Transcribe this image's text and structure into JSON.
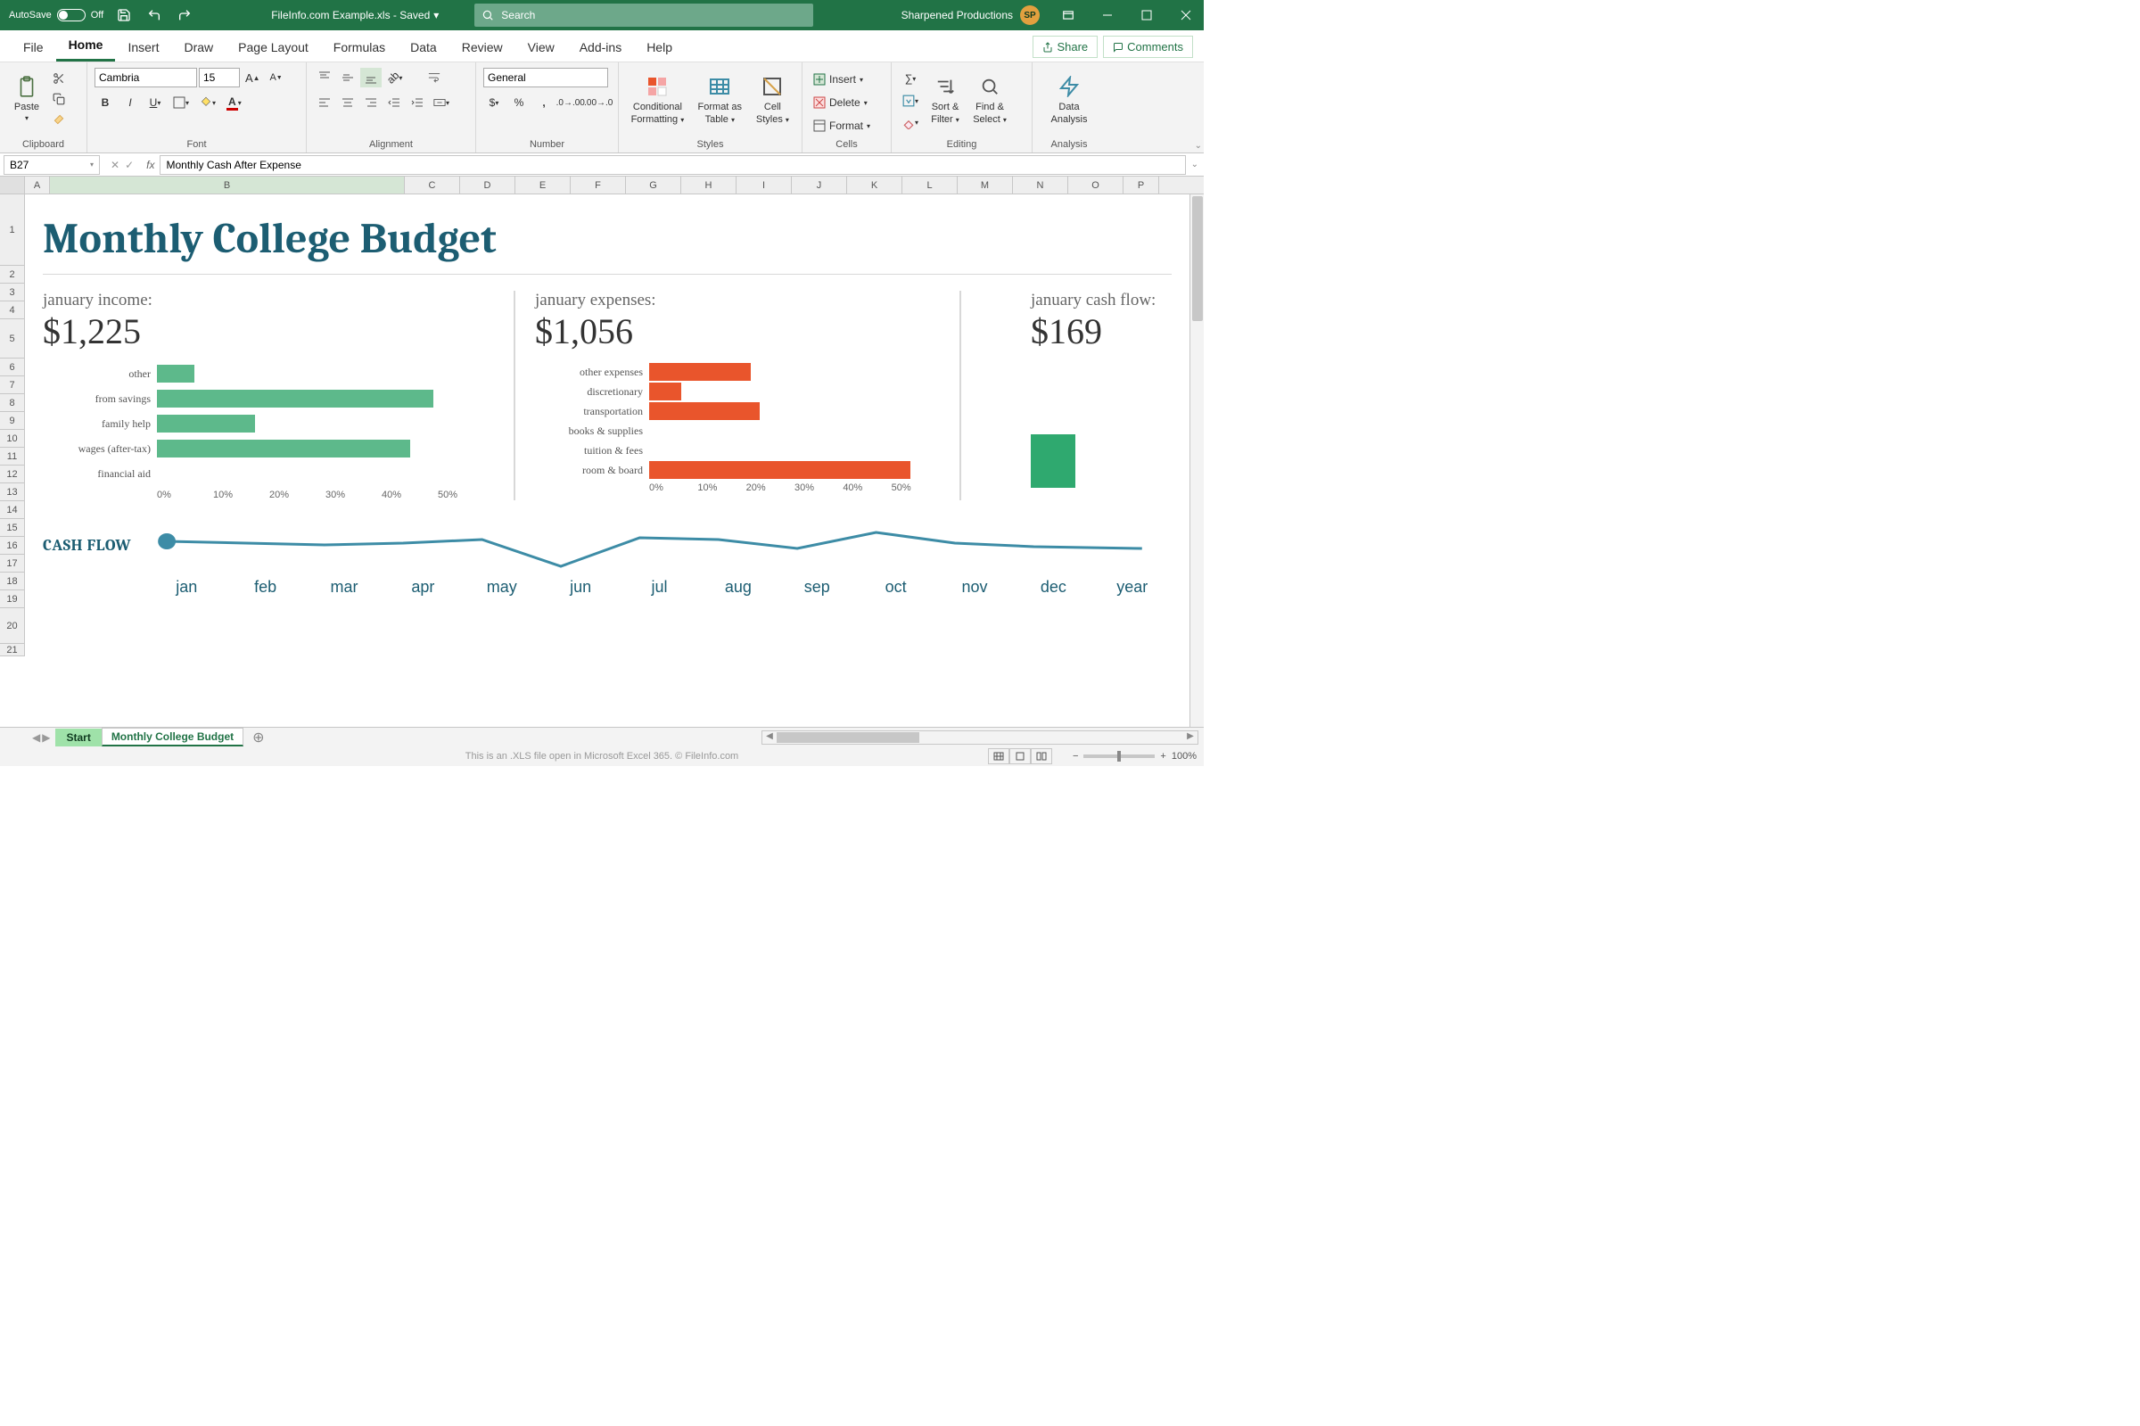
{
  "title_bar": {
    "autosave_label": "AutoSave",
    "autosave_state": "Off",
    "doc_title": "FileInfo.com Example.xls - Saved",
    "search_placeholder": "Search",
    "user_name": "Sharpened Productions",
    "user_initials": "SP"
  },
  "ribbon": {
    "tabs": [
      "File",
      "Home",
      "Insert",
      "Draw",
      "Page Layout",
      "Formulas",
      "Data",
      "Review",
      "View",
      "Add-ins",
      "Help"
    ],
    "active_tab_index": 1,
    "share": "Share",
    "comments": "Comments",
    "clipboard_label": "Clipboard",
    "paste": "Paste",
    "font_label": "Font",
    "font_name": "Cambria",
    "font_size": "15",
    "alignment_label": "Alignment",
    "number_label": "Number",
    "number_format": "General",
    "styles_label": "Styles",
    "conditional": "Conditional",
    "formatting": "Formatting",
    "format_as": "Format as",
    "table": "Table",
    "cell": "Cell",
    "styles2": "Styles",
    "cells_label": "Cells",
    "insert": "Insert",
    "delete": "Delete",
    "format": "Format",
    "editing_label": "Editing",
    "sort_filter1": "Sort &",
    "sort_filter2": "Filter",
    "find_select1": "Find &",
    "find_select2": "Select",
    "analysis_label": "Analysis",
    "data_analysis1": "Data",
    "data_analysis2": "Analysis"
  },
  "formula_bar": {
    "name_box": "B27",
    "formula": "Monthly Cash After Expense"
  },
  "sheet": {
    "columns": [
      "A",
      "B",
      "C",
      "D",
      "E",
      "F",
      "G",
      "H",
      "I",
      "J",
      "K",
      "L",
      "M",
      "N",
      "O",
      "P"
    ],
    "title": "Monthly College Budget",
    "income_label": "january income:",
    "income_value": "$1,225",
    "expenses_label": "january expenses:",
    "expenses_value": "$1,056",
    "cashflow_label_hdr": "january cash flow:",
    "cashflow_value": "$169",
    "cashflow_header": "CASH FLOW",
    "months": [
      "jan",
      "feb",
      "mar",
      "apr",
      "may",
      "jun",
      "jul",
      "aug",
      "sep",
      "oct",
      "nov",
      "dec",
      "year"
    ]
  },
  "chart_data": [
    {
      "type": "bar",
      "orientation": "horizontal",
      "title": "january income",
      "categories": [
        "other",
        "from savings",
        "family help",
        "wages (after-tax)",
        "financial aid"
      ],
      "values": [
        6,
        45,
        16,
        41,
        0
      ],
      "xlabel": "",
      "ylabel": "",
      "xticks": [
        "0%",
        "10%",
        "20%",
        "30%",
        "40%",
        "50%"
      ],
      "xlim": [
        0,
        55
      ],
      "color": "#5db98b"
    },
    {
      "type": "bar",
      "orientation": "horizontal",
      "title": "january expenses",
      "categories": [
        "other expenses",
        "discretionary",
        "transportation",
        "books & supplies",
        "tuition & fees",
        "room & board"
      ],
      "values": [
        19,
        6,
        21,
        0,
        0,
        49.5
      ],
      "xlabel": "",
      "ylabel": "",
      "xticks": [
        "0%",
        "10%",
        "20%",
        "30%",
        "40%",
        "50%"
      ],
      "xlim": [
        0,
        55
      ],
      "color": "#e9552c"
    },
    {
      "type": "bar",
      "orientation": "vertical",
      "title": "january cash flow single bar",
      "categories": [
        ""
      ],
      "values": [
        55
      ],
      "ylim": [
        0,
        100
      ],
      "color": "#2fa96f"
    },
    {
      "type": "line",
      "title": "monthly cash flow sparkline",
      "x": [
        "jan",
        "feb",
        "mar",
        "apr",
        "may",
        "jun",
        "jul",
        "aug",
        "sep",
        "oct",
        "nov",
        "dec",
        "year"
      ],
      "values": [
        169,
        160,
        155,
        160,
        170,
        60,
        175,
        170,
        140,
        190,
        160,
        145,
        140
      ],
      "ylim": [
        0,
        200
      ],
      "marker_index": 0,
      "color": "#3d8ca6"
    }
  ],
  "sheet_tabs": {
    "start": "Start",
    "active": "Monthly College Budget"
  },
  "status_bar": {
    "footer": "This is an .XLS file open in Microsoft Excel 365. © FileInfo.com",
    "zoom": "100%"
  }
}
